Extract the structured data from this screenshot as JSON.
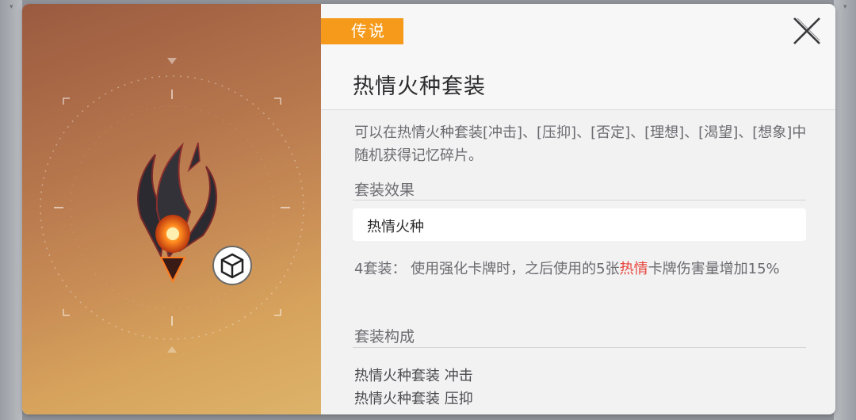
{
  "rarity": "传说",
  "set_title": "热情火种套装",
  "description": "可以在热情火种套装[冲击]、[压抑]、[否定]、[理想]、[渴望]、[想象]中随机获得记忆碎片。",
  "effect_section_label": "套装效果",
  "effect_name": "热情火种",
  "bonus": {
    "prefix": "4套装：  使用强化卡牌时，之后使用的5张",
    "highlight": "热情",
    "suffix": "卡牌伤害量增加15%"
  },
  "composition_section_label": "套装构成",
  "pieces": [
    "热情火种套装 冲击",
    "热情火种套装 压抑"
  ],
  "icons": {
    "close": "close-icon",
    "item_type": "cube-icon",
    "artifact": "flame-crest-icon"
  },
  "colors": {
    "rarity": "#f59a1b",
    "highlight": "#e8433a"
  }
}
